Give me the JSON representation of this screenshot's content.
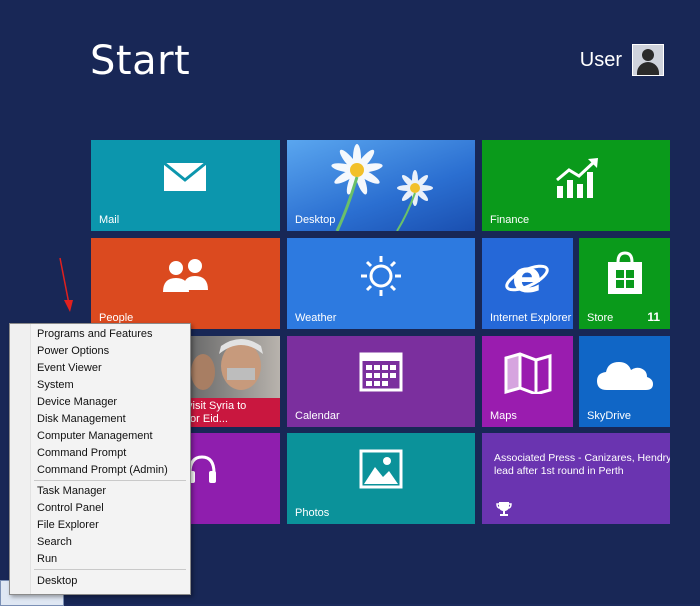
{
  "screen": {
    "title": "Start",
    "user": "User"
  },
  "colors": {
    "background": "#182756",
    "mail": "#0c96ad",
    "desktop": "#2b6fd1",
    "finance": "#0a9a1b",
    "people": "#db4a1f",
    "weather": "#2d7ae0",
    "ie": "#2568d8",
    "store": "#0a9a1b",
    "news": "#c9173f",
    "calendar": "#7b2f9e",
    "maps": "#9a1caf",
    "skydrive": "#1066c6",
    "music": "#8f1eae",
    "photos": "#0b929a",
    "sports": "#6a34b0"
  },
  "tiles": {
    "mail": {
      "label": "Mail",
      "icon": "envelope-icon"
    },
    "desktop": {
      "label": "Desktop",
      "icon": "daisy-wallpaper"
    },
    "finance": {
      "label": "Finance",
      "icon": "chart-up-icon"
    },
    "people": {
      "label": "People",
      "icon": "people-icon"
    },
    "weather": {
      "label": "Weather",
      "icon": "sun-icon"
    },
    "ie": {
      "label": "Internet Explorer",
      "icon": "ie-icon"
    },
    "store": {
      "label": "Store",
      "badge": "11",
      "icon": "store-bag-icon"
    },
    "news": {
      "headline_line1": "visit Syria to",
      "headline_line2": "for Eid..."
    },
    "calendar": {
      "label": "Calendar",
      "icon": "calendar-icon"
    },
    "maps": {
      "label": "Maps",
      "icon": "map-icon"
    },
    "skydrive": {
      "label": "SkyDrive",
      "icon": "cloud-icon"
    },
    "photos": {
      "label": "Photos",
      "icon": "photo-icon"
    },
    "sports": {
      "headline_line1": "Associated Press - Canizares, Hendry",
      "headline_line2": "lead after 1st round in Perth",
      "icon": "trophy-icon"
    }
  },
  "context_menu": {
    "group1": [
      "Programs and Features",
      "Power Options",
      "Event Viewer",
      "System",
      "Device Manager",
      "Disk Management",
      "Computer Management",
      "Command Prompt",
      "Command Prompt (Admin)"
    ],
    "group2": [
      "Task Manager",
      "Control Panel",
      "File Explorer",
      "Search",
      "Run"
    ],
    "group3": [
      "Desktop"
    ]
  }
}
